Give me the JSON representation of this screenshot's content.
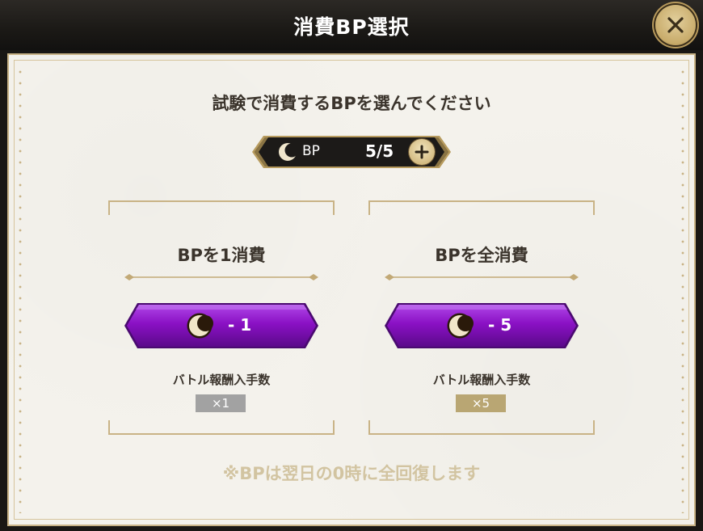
{
  "header": {
    "title": "消費BP選択"
  },
  "prompt": "試験で消費するBPを選んでください",
  "bp_bar": {
    "label": "BP",
    "value": "5/5"
  },
  "options": [
    {
      "title": "BPを1消費",
      "button_text": "- 1",
      "reward_label": "バトル報酬入手数",
      "multiplier": "×1"
    },
    {
      "title": "BPを全消費",
      "button_text": "- 5",
      "reward_label": "バトル報酬入手数",
      "multiplier": "×5"
    }
  ],
  "footnote": "※BPは翌日の0時に全回復します",
  "colors": {
    "accent_gold": "#c8ab6a",
    "button_purple": "#8a10c4",
    "paper": "#f4f2ec",
    "multiplier_inactive": "#a2a2a2",
    "multiplier_active": "#b9a673"
  },
  "icons": {
    "close": "close-x-icon",
    "bp": "crescent-moon-icon",
    "add": "plus-icon"
  }
}
